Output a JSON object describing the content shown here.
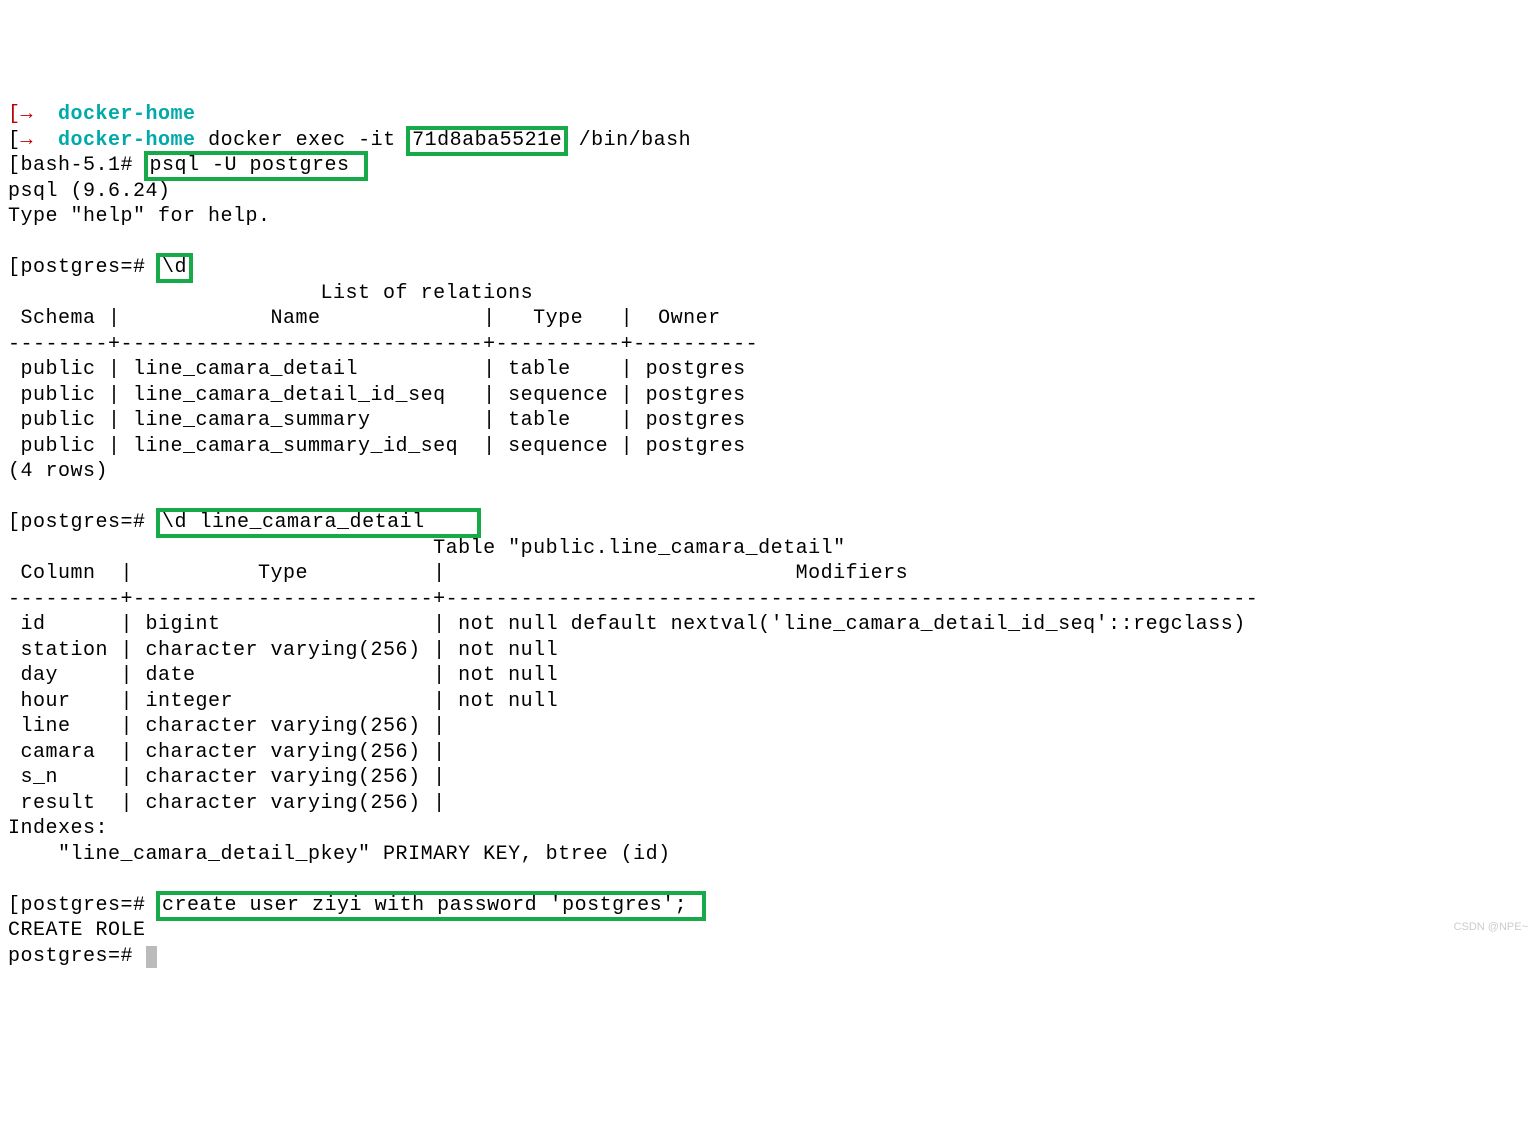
{
  "line0": {
    "prefix": "[→  ",
    "host": "docker-home"
  },
  "line1": {
    "prefix": "[",
    "arrow": "→  ",
    "host": "docker-home",
    "cmd_pre": " docker exec -it ",
    "container_id": "71d8aba5521e",
    "cmd_post": " /bin/bash"
  },
  "line2": {
    "prefix": "[bash-5.1# ",
    "cmd": "psql -U postgres "
  },
  "line3": "psql (9.6.24)",
  "line4": "Type \"help\" for help.",
  "blank": "",
  "line6": {
    "prefix": "[postgres=# ",
    "cmd": "\\d"
  },
  "relations_title": "                         List of relations",
  "relations_header": " Schema |            Name             |   Type   |  Owner   ",
  "relations_sep": "--------+-----------------------------+----------+----------",
  "relations_rows": [
    " public | line_camara_detail          | table    | postgres",
    " public | line_camara_detail_id_seq   | sequence | postgres",
    " public | line_camara_summary         | table    | postgres",
    " public | line_camara_summary_id_seq  | sequence | postgres"
  ],
  "relations_count": "(4 rows)",
  "line_desc": {
    "prefix": "[postgres=# ",
    "cmd": "\\d line_camara_detail    "
  },
  "table_title": "                                  Table \"public.line_camara_detail\"",
  "table_header": " Column  |          Type          |                            Modifiers                            ",
  "table_sep": "---------+------------------------+-----------------------------------------------------------------",
  "table_rows": [
    " id      | bigint                 | not null default nextval('line_camara_detail_id_seq'::regclass)",
    " station | character varying(256) | not null",
    " day     | date                   | not null",
    " hour    | integer                | not null",
    " line    | character varying(256) | ",
    " camara  | character varying(256) | ",
    " s_n     | character varying(256) | ",
    " result  | character varying(256) | "
  ],
  "indexes_label": "Indexes:",
  "indexes_line": "    \"line_camara_detail_pkey\" PRIMARY KEY, btree (id)",
  "create_user": {
    "prefix": "[postgres=# ",
    "cmd": "create user ziyi with password 'postgres'; "
  },
  "create_role_out": "CREATE ROLE",
  "final_prompt": "postgres=# ",
  "watermark": "CSDN @NPE~"
}
